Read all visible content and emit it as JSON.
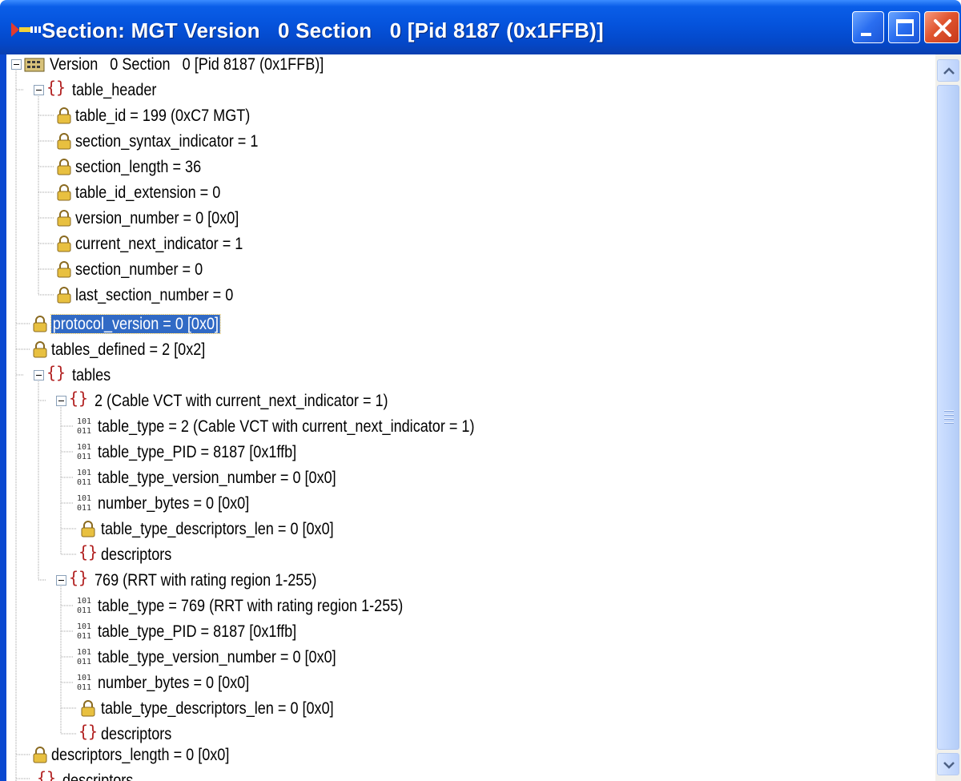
{
  "window": {
    "title": "Section: MGT Version   0 Section   0 [Pid 8187 (0x1FFB)]"
  },
  "tree": {
    "nodes": [
      {
        "label": "Version   0 Section   0 [Pid 8187 (0x1FFB)]",
        "icon": "grid-icon"
      },
      {
        "label": "table_header",
        "icon": "braces-icon"
      },
      {
        "label": "table_id = 199 (0xC7 MGT)",
        "icon": "lock-icon"
      },
      {
        "label": "section_syntax_indicator = 1",
        "icon": "lock-icon"
      },
      {
        "label": "section_length = 36",
        "icon": "lock-icon"
      },
      {
        "label": "table_id_extension = 0",
        "icon": "lock-icon"
      },
      {
        "label": "version_number = 0 [0x0]",
        "icon": "lock-icon"
      },
      {
        "label": "current_next_indicator = 1",
        "icon": "lock-icon"
      },
      {
        "label": "section_number = 0",
        "icon": "lock-icon"
      },
      {
        "label": "last_section_number = 0",
        "icon": "lock-icon"
      },
      {
        "label": "protocol_version = 0 [0x0]",
        "icon": "lock-icon",
        "selected": true
      },
      {
        "label": "tables_defined = 2 [0x2]",
        "icon": "lock-icon"
      },
      {
        "label": "tables",
        "icon": "braces-icon"
      },
      {
        "label": "2 (Cable VCT with current_next_indicator = 1)",
        "icon": "braces-icon"
      },
      {
        "label": "table_type = 2 (Cable VCT with current_next_indicator = 1)",
        "icon": "binary-icon"
      },
      {
        "label": "table_type_PID = 8187 [0x1ffb]",
        "icon": "binary-icon"
      },
      {
        "label": "table_type_version_number = 0 [0x0]",
        "icon": "binary-icon"
      },
      {
        "label": "number_bytes = 0 [0x0]",
        "icon": "binary-icon"
      },
      {
        "label": "table_type_descriptors_len = 0 [0x0]",
        "icon": "lock-icon"
      },
      {
        "label": "descriptors",
        "icon": "braces-icon"
      },
      {
        "label": "769 (RRT with rating region 1-255)",
        "icon": "braces-icon"
      },
      {
        "label": "table_type = 769 (RRT with rating region 1-255)",
        "icon": "binary-icon"
      },
      {
        "label": "table_type_PID = 8187 [0x1ffb]",
        "icon": "binary-icon"
      },
      {
        "label": "table_type_version_number = 0 [0x0]",
        "icon": "binary-icon"
      },
      {
        "label": "number_bytes = 0 [0x0]",
        "icon": "binary-icon"
      },
      {
        "label": "table_type_descriptors_len = 0 [0x0]",
        "icon": "lock-icon"
      },
      {
        "label": "descriptors",
        "icon": "braces-icon"
      },
      {
        "label": "descriptors_length = 0 [0x0]",
        "icon": "lock-icon"
      },
      {
        "label": "descriptors",
        "icon": "braces-icon"
      }
    ]
  },
  "colors": {
    "titlebar": "#0553dc",
    "selection": "#316ac5",
    "braces": "#b22222",
    "lock": "#d4a72c"
  }
}
